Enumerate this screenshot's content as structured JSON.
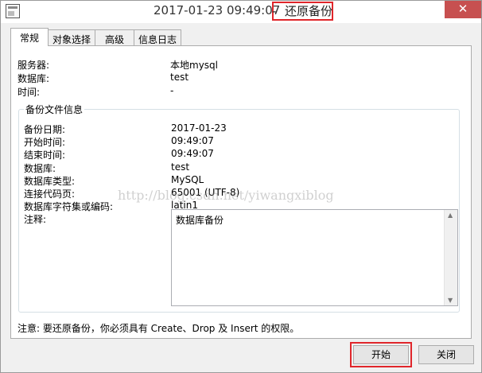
{
  "titlebar": {
    "time": "2017-01-23 09:49:07",
    "dash": "-",
    "name": "还原备份",
    "close": "✕"
  },
  "tabs": [
    "常规",
    "对象选择",
    "高级",
    "信息日志"
  ],
  "general": [
    {
      "label": "服务器:",
      "value": "本地mysql"
    },
    {
      "label": "数据库:",
      "value": "test"
    },
    {
      "label": "时间:",
      "value": "-"
    }
  ],
  "backup_info": {
    "title": "备份文件信息",
    "rows": [
      {
        "label": "备份日期:",
        "value": "2017-01-23"
      },
      {
        "label": "开始时间:",
        "value": "09:49:07"
      },
      {
        "label": "结束时间:",
        "value": "09:49:07"
      },
      {
        "label": "数据库:",
        "value": "test"
      },
      {
        "label": "数据库类型:",
        "value": "MySQL"
      },
      {
        "label": "连接代码页:",
        "value": "65001 (UTF-8)"
      },
      {
        "label": "数据库字符集或编码:",
        "value": "latin1"
      }
    ],
    "notes_label": "注释:",
    "notes_value": "数据库备份"
  },
  "warning": "注意: 要还原备份，你必须具有 Create、Drop 及 Insert 的权限。",
  "buttons": {
    "start": "开始",
    "close": "关闭"
  },
  "watermark": "http://blog.csdn.net/yiwangxiblog"
}
